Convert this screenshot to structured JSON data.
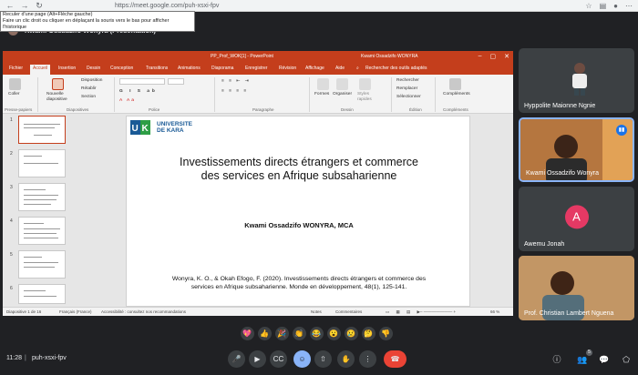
{
  "browser": {
    "url": "https://meet.google.com/puh-xsxi-fpv",
    "tooltip_line1": "Reculer d'une page (Alt+Flèche gauche)",
    "tooltip_line2": "Faire un clic droit ou cliquer en déplaçant la souris vers le bas pour afficher l'historique",
    "back": "←",
    "forward": "→",
    "reload": "↻"
  },
  "presenter": {
    "name": "Kwami Ossadzifo Wonyra (Présentation)"
  },
  "ppt": {
    "window_title": "PP_Prof_WOK[1] - PowerPoint",
    "user": "Kwami Ossadzifo WONYRA",
    "tabs": [
      "Fichier",
      "Accueil",
      "Insertion",
      "Dessin",
      "Conception",
      "Transitions",
      "Animations",
      "Diaporama",
      "Enregistrer",
      "Révision",
      "Affichage",
      "Aide"
    ],
    "search": "Rechercher des outils adaptés",
    "ribbon": {
      "paste": "Coller",
      "new_slide": "Nouvelle diapositive",
      "layout": "Disposition",
      "reset": "Rétablir",
      "section": "Section",
      "clipboard_group": "Presse-papiers",
      "slides_group": "Diapositives",
      "font_group": "Police",
      "para_group": "Paragraphe",
      "shapes": "Formes",
      "arrange": "Organiser",
      "styles": "Styles rapides",
      "drawing_group": "Dessin",
      "find": "Rechercher",
      "replace": "Remplacer",
      "select": "Sélectionner",
      "edit_group": "Édition",
      "addins": "Compléments",
      "addins_group": "Compléments"
    },
    "thumb_numbers": [
      "1",
      "2",
      "3",
      "4",
      "5",
      "6"
    ],
    "slide": {
      "logo_line1": "UNIVERSITE",
      "logo_line2": "DE KARA",
      "title_line1": "Investissements directs étrangers et commerce",
      "title_line2": "des services en Afrique subsaharienne",
      "author": "Kwami Ossadzifo WONYRA, MCA",
      "ref_line1": "Wonyra, K. O., & Okah Efogo, F. (2020). Investissements directs étrangers et commerce des",
      "ref_line2": "services en Afrique subsaharienne. Monde en développement, 48(1), 125-141."
    },
    "status": {
      "slide_count": "Diapositive 1 de 16",
      "language": "Français (France)",
      "accessibility": "Accessibilité : consultez nos recommandations",
      "notes": "Notes",
      "comments": "Commentaires",
      "zoom": "66 %"
    }
  },
  "participants": [
    {
      "name": "Hyppolite Maionne Ngnie"
    },
    {
      "name": "Kwami Ossadzifo Wonyra"
    },
    {
      "name": "Awemu Jonah",
      "initial": "A"
    },
    {
      "name": "Prof. Christian Lambert Nguena"
    }
  ],
  "reactions": [
    "💖",
    "👍",
    "🎉",
    "👏",
    "😂",
    "😮",
    "😢",
    "🤔",
    "👎"
  ],
  "bottom": {
    "time": "11:28",
    "separator": "|",
    "meeting_code": "puh-xsxi-fpv",
    "participant_count": "5"
  }
}
